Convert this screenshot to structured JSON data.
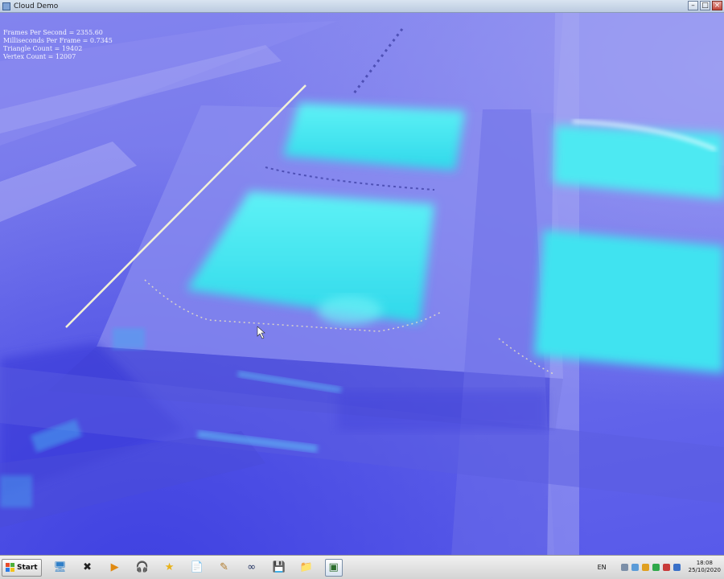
{
  "window": {
    "title": "Cloud Demo",
    "buttons": {
      "minimize": "–",
      "maximize": "□",
      "close": "×"
    }
  },
  "stats": {
    "fps": "Frames Per Second = 2355.60",
    "ms_per_frame": "Milliseconds Per Frame = 0.7345",
    "triangle_count": "Triangle Count = 19402",
    "vertex_count": "Vertex Count = 12007"
  },
  "colors": {
    "ground": "#7476ec",
    "highlight": "#3ee6f0",
    "road": "#5a5cd8"
  },
  "taskbar": {
    "start_label": "Start",
    "icons": [
      {
        "name": "monitor-icon",
        "glyph": "🖥",
        "color": "#2f7fc8"
      },
      {
        "name": "x-app-icon",
        "glyph": "✖",
        "color": "#222222"
      },
      {
        "name": "media-player-icon",
        "glyph": "▶",
        "color": "#e08a12"
      },
      {
        "name": "headphones-icon",
        "glyph": "🎧",
        "color": "#8a2a1c"
      },
      {
        "name": "star-app-icon",
        "glyph": "★",
        "color": "#e8b21a"
      },
      {
        "name": "document-icon",
        "glyph": "📄",
        "color": "#5a82b6"
      },
      {
        "name": "tools-icon",
        "glyph": "✎",
        "color": "#b07a2a"
      },
      {
        "name": "infinity-app-icon",
        "glyph": "∞",
        "color": "#203060"
      },
      {
        "name": "save-disk-icon",
        "glyph": "💾",
        "color": "#1a1a1a"
      },
      {
        "name": "folder-icon",
        "glyph": "📁",
        "color": "#d9b23a"
      },
      {
        "name": "active-window-icon",
        "glyph": "▣",
        "color": "#2d6e2d"
      }
    ],
    "tray": {
      "language": "EN",
      "time": "18:08",
      "date": "25/10/2020"
    }
  }
}
